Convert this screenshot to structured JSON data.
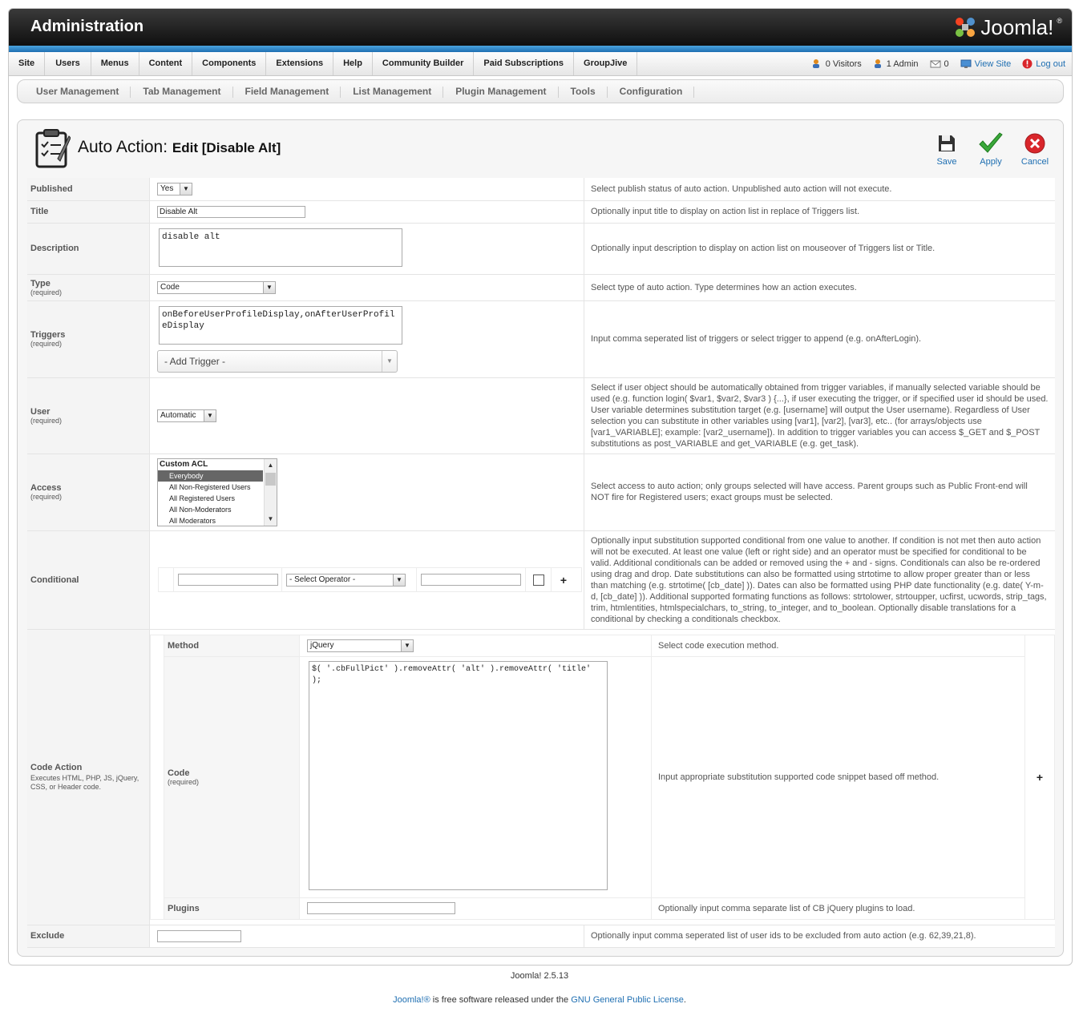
{
  "header": {
    "title": "Administration",
    "logo_text": "Joomla!",
    "logo_mark": "®"
  },
  "menu": {
    "items": [
      "Site",
      "Users",
      "Menus",
      "Content",
      "Components",
      "Extensions",
      "Help",
      "Community Builder",
      "Paid Subscriptions",
      "GroupJive"
    ],
    "status": {
      "visitors": "0 Visitors",
      "admins": "1 Admin",
      "messages": "0",
      "view_site": "View Site",
      "logout": "Log out"
    }
  },
  "submenu": {
    "items": [
      "User Management",
      "Tab Management",
      "Field Management",
      "List Management",
      "Plugin Management",
      "Tools",
      "Configuration"
    ]
  },
  "page": {
    "title": "Auto Action:",
    "subtitle": "Edit [Disable Alt]"
  },
  "toolbar": {
    "save": "Save",
    "apply": "Apply",
    "cancel": "Cancel"
  },
  "form": {
    "published": {
      "label": "Published",
      "value": "Yes",
      "desc": "Select publish status of auto action. Unpublished auto action will not execute."
    },
    "title": {
      "label": "Title",
      "value": "Disable Alt",
      "desc": "Optionally input title to display on action list in replace of Triggers list."
    },
    "description": {
      "label": "Description",
      "value": "disable alt",
      "desc": "Optionally input description to display on action list on mouseover of Triggers list or Title."
    },
    "type": {
      "label": "Type",
      "required": "(required)",
      "value": "Code",
      "desc": "Select type of auto action. Type determines how an action executes."
    },
    "triggers": {
      "label": "Triggers",
      "required": "(required)",
      "value": "onBeforeUserProfileDisplay,onAfterUserProfileDisplay",
      "add_trigger": "- Add Trigger -",
      "desc": "Input comma seperated list of triggers or select trigger to append (e.g. onAfterLogin)."
    },
    "user": {
      "label": "User",
      "required": "(required)",
      "value": "Automatic",
      "desc": "Select if user object should be automatically obtained from trigger variables, if manually selected variable should be used (e.g. function login( $var1, $var2, $var3 ) {...}, if user executing the trigger, or if specified user id should be used. User variable determines substitution target (e.g. [username] will output the User username). Regardless of User selection you can substitute in other variables using [var1], [var2], [var3], etc.. (for arrays/objects use [var1_VARIABLE]; example: [var2_username]). In addition to trigger variables you can access $_GET and $_POST substitutions as post_VARIABLE and get_VARIABLE (e.g. get_task)."
    },
    "access": {
      "label": "Access",
      "required": "(required)",
      "group": "Custom ACL",
      "options": [
        "Everybody",
        "All Non-Registered Users",
        "All Registered Users",
        "All Non-Moderators",
        "All Moderators"
      ],
      "selected": "Everybody",
      "desc": "Select access to auto action; only groups selected will have access. Parent groups such as Public Front-end will NOT fire for Registered users; exact groups must be selected."
    },
    "conditional": {
      "label": "Conditional",
      "operator": "- Select Operator -",
      "add": "+",
      "desc": "Optionally input substitution supported conditional from one value to another. If condition is not met then auto action will not be executed. At least one value (left or right side) and an operator must be specified for conditional to be valid. Additional conditionals can be added or removed using the + and - signs. Conditionals can also be re-ordered using drag and drop. Date substitutions can also be formatted using strtotime to allow proper greater than or less than matching (e.g. strtotime( [cb_date] )). Dates can also be formatted using PHP date functionality (e.g. date( Y-m-d, [cb_date] )). Additional supported formating functions as follows: strtolower, strtoupper, ucfirst, ucwords, strip_tags, trim, htmlentities, htmlspecialchars, to_string, to_integer, and to_boolean. Optionally disable translations for a conditional by checking a conditionals checkbox."
    },
    "code_action": {
      "label": "Code Action",
      "hint": "Executes HTML, PHP, JS, jQuery, CSS, or Header code.",
      "method": {
        "label": "Method",
        "value": "jQuery",
        "desc": "Select code execution method."
      },
      "code": {
        "label": "Code",
        "required": "(required)",
        "value": "$( '.cbFullPict' ).removeAttr( 'alt' ).removeAttr( 'title' );",
        "desc": "Input appropriate substitution supported code snippet based off method."
      },
      "plugins": {
        "label": "Plugins",
        "value": "",
        "desc": "Optionally input comma separate list of CB jQuery plugins to load."
      },
      "add": "+"
    },
    "exclude": {
      "label": "Exclude",
      "value": "",
      "desc": "Optionally input comma seperated list of user ids to be excluded from auto action (e.g. 62,39,21,8)."
    }
  },
  "footer": {
    "version": "Joomla! 2.5.13",
    "license_prefix": "Joomla!®",
    "license_mid": " is free software released under the ",
    "license_link": "GNU General Public License",
    "license_end": "."
  },
  "colors": {
    "link": "#1f6fb2",
    "header": "#1a1a1a",
    "accent_bar": "#2f86c8",
    "apply": "#3aa83a",
    "cancel": "#d9262b"
  }
}
